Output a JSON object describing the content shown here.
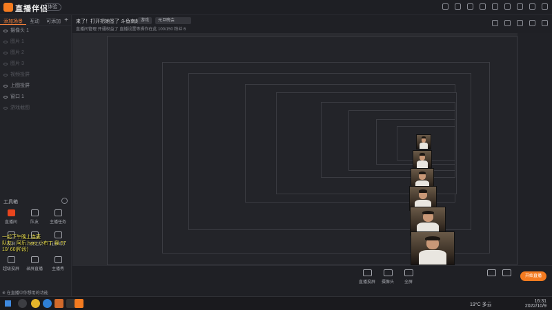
{
  "app": {
    "brand": "直播伴侣",
    "version_badge": "体验"
  },
  "left_panel": {
    "tabs": [
      "添加场景",
      "互动",
      "可添加"
    ],
    "scenes": [
      {
        "label": "摄像头 1",
        "dim": false
      },
      {
        "label": "图片 1",
        "dim": true
      },
      {
        "label": "图片 2",
        "dim": true
      },
      {
        "label": "图片 3",
        "dim": true
      },
      {
        "label": "视频投屏",
        "dim": true
      },
      {
        "label": "上图投屏",
        "dim": false
      },
      {
        "label": "窗口 1",
        "dim": false
      },
      {
        "label": "游戏截图",
        "dim": true
      }
    ],
    "tools_heading": "工具箱",
    "tools": [
      "直播间",
      "队友",
      "主播任务",
      "投屏",
      "上麦连接",
      "直播助手",
      "超级投屏",
      "录屏直播",
      "主播秀"
    ],
    "overlay_lines": [
      "一起下午晚上连麦",
      "队友：阿乐 haro 小布丁 我 57",
      "10/ 60(阶段)"
    ]
  },
  "header": {
    "title": "来了！打开把她签了 斗鱼南起来",
    "pill_category": "游戏",
    "pill_title": "元旦晚会",
    "subline": "直播间管理  开通权益了  直播设置等操作在此  100/150  粉丝 6"
  },
  "controls": {
    "buttons": [
      "直播投屏",
      "摄像头",
      "全屏"
    ],
    "start_live": "开始直播"
  },
  "taskbar": {
    "status_text": "※ 在直播中你想用的功能",
    "weather": "19°C  多云",
    "time": "16:31",
    "date": "2022/10/9"
  }
}
